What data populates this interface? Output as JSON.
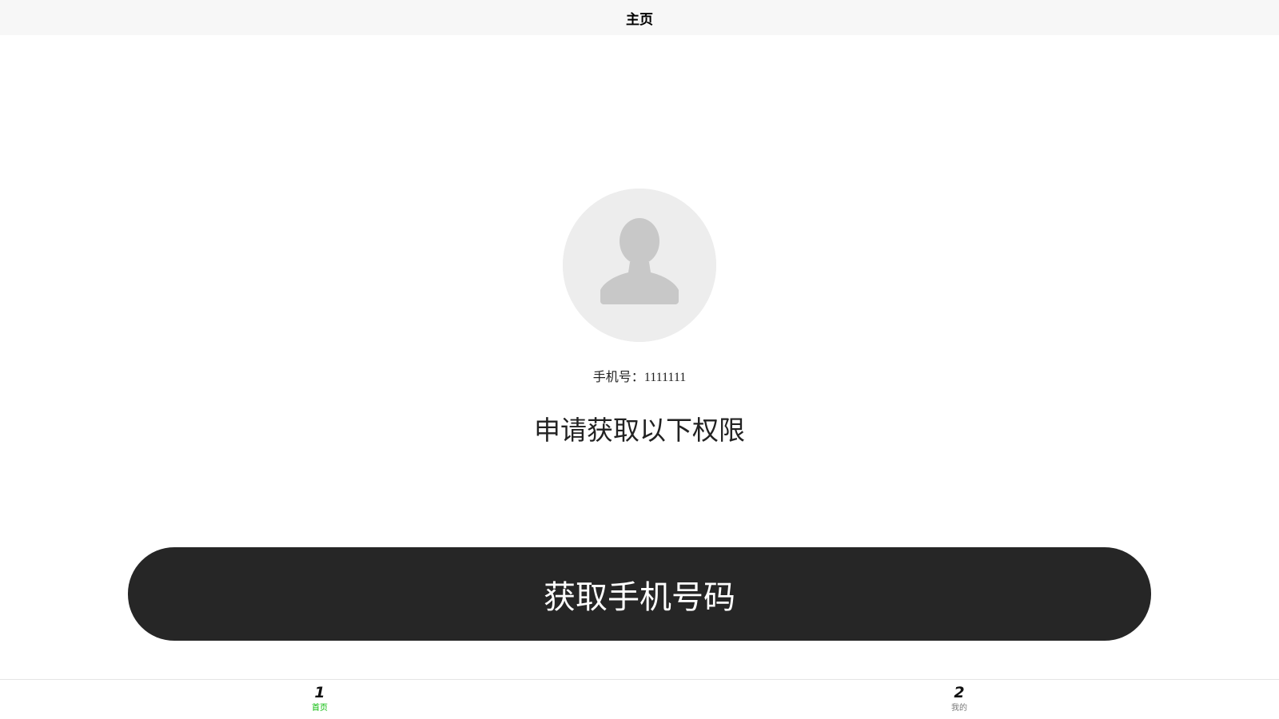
{
  "nav": {
    "title": "主页"
  },
  "profile": {
    "avatar_icon": "user-placeholder-icon",
    "phone_label": "手机号：",
    "phone_value": "1111111"
  },
  "permission": {
    "title": "申请获取以下权限"
  },
  "action": {
    "get_phone_label": "获取手机号码"
  },
  "tabs": [
    {
      "icon_text": "1",
      "label": "首页",
      "active": true,
      "active_color": "#09bb07"
    },
    {
      "icon_text": "2",
      "label": "我的",
      "active": false,
      "inactive_color": "#7a7a7a"
    }
  ],
  "colors": {
    "nav_background": "#f7f7f7",
    "button_background": "#262626",
    "button_text": "#ffffff",
    "avatar_background": "#ededed",
    "avatar_figure": "#c8c8c8"
  }
}
